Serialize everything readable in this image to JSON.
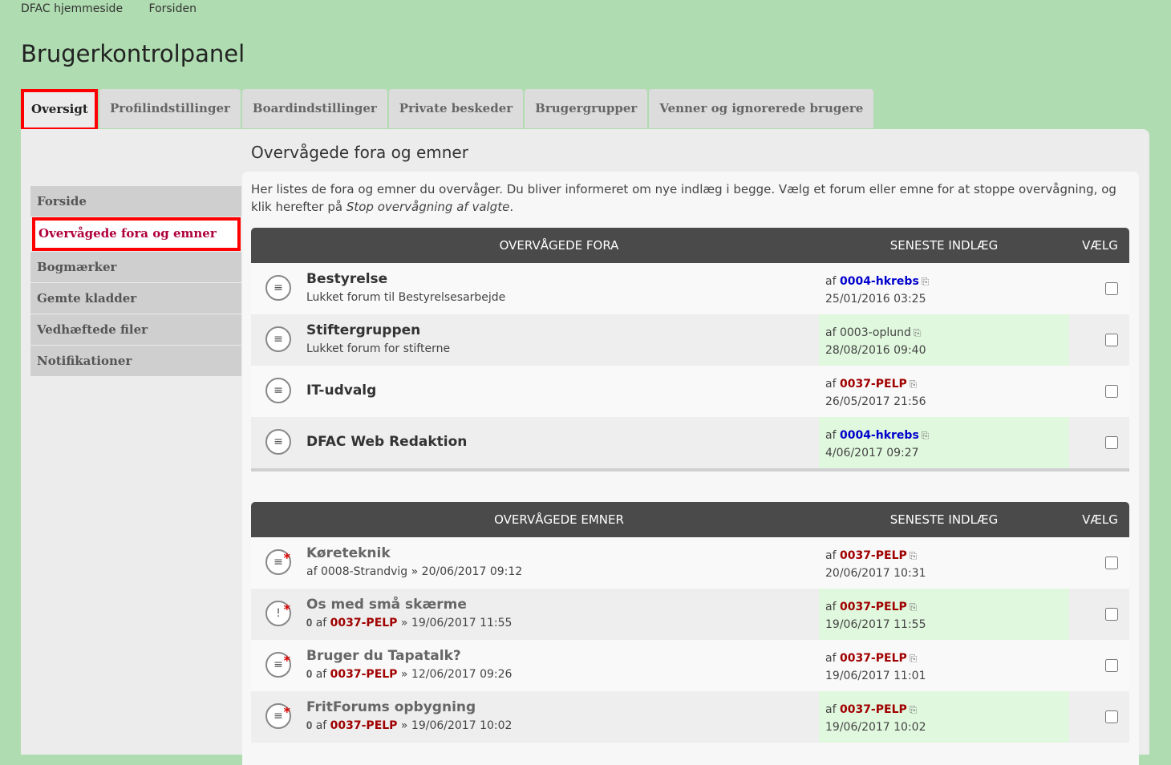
{
  "topnav": [
    "DFAC hjemmeside",
    "Forsiden"
  ],
  "page_title": "Brugerkontrolpanel",
  "tabs": [
    "Oversigt",
    "Profilindstillinger",
    "Boardindstillinger",
    "Private beskeder",
    "Brugergrupper",
    "Venner og ignorerede brugere"
  ],
  "sidebar": [
    "Forside",
    "Overvågede fora og emner",
    "Bogmærker",
    "Gemte kladder",
    "Vedhæftede filer",
    "Notifikationer"
  ],
  "section_title": "Overvågede fora og emner",
  "intro": {
    "text": "Her listes de fora og emner du overvåger. Du bliver informeret om nye indlæg i begge. Vælg et forum eller emne for at stoppe overvågning, og klik herefter på ",
    "emph": "Stop overvågning af valgte",
    "end": "."
  },
  "forums": {
    "headers": [
      "Overvågede fora",
      "Seneste indlæg",
      "Vælg"
    ],
    "rows": [
      {
        "title": "Bestyrelse",
        "desc": "Lukket forum til Bestyrelsesarbejde",
        "af": "af",
        "user": "0004-hkrebs",
        "date": "25/01/2016 03:25"
      },
      {
        "title": "Stiftergruppen",
        "desc": "Lukket forum for stifterne",
        "af": "af",
        "user": "0003-oplund",
        "date": "28/08/2016 09:40"
      },
      {
        "title": "IT-udvalg",
        "desc": "",
        "af": "af",
        "user": "0037-PELP",
        "date": "26/05/2017 21:56"
      },
      {
        "title": "DFAC Web Redaktion",
        "desc": "",
        "af": "af",
        "user": "0004-hkrebs",
        "date": "4/06/2017 09:27"
      }
    ]
  },
  "topics": {
    "headers": [
      "Overvågede emner",
      "Seneste indlæg",
      "Vælg"
    ],
    "rows": [
      {
        "title": "Køreteknik",
        "meta_af": "af",
        "author": "0008-Strandvig",
        "sep": "»",
        "posted": "20/06/2017 09:12",
        "af": "af",
        "user": "0037-PELP",
        "date": "20/06/2017 10:31"
      },
      {
        "title": "Os med små skærme",
        "meta_af": "af",
        "author": "0037-PELP",
        "sep": "»",
        "posted": "19/06/2017 11:55",
        "af": "af",
        "user": "0037-PELP",
        "date": "19/06/2017 11:55"
      },
      {
        "title": "Bruger du Tapatalk?",
        "meta_af": "af",
        "author": "0037-PELP",
        "sep": "»",
        "posted": "12/06/2017 09:26",
        "af": "af",
        "user": "0037-PELP",
        "date": "19/06/2017 11:01"
      },
      {
        "title": "FritForums opbygning",
        "meta_af": "af",
        "author": "0037-PELP",
        "sep": "»",
        "posted": "19/06/2017 10:02",
        "af": "af",
        "user": "0037-PELP",
        "date": "19/06/2017 10:02"
      }
    ]
  },
  "colors": {
    "background": "#afdcb0",
    "active_tab_outline": "#ff0000",
    "user_blue": "#0000cc",
    "user_red": "#a00000",
    "latest_highlight": "#e0f8de"
  },
  "icons": {
    "forum": "forum-read-icon",
    "topic": "topic-unread-icon",
    "attachment": "paperclip-icon",
    "view_latest": "view-latest-post-icon"
  }
}
